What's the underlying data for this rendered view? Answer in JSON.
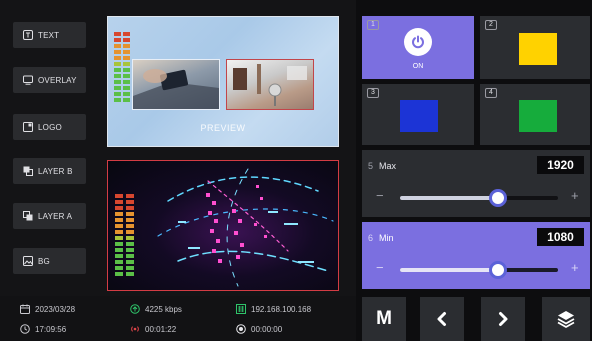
{
  "sources": {
    "text": "TEXT",
    "overlay": "OVERLAY",
    "logo": "LOGO",
    "layer_b": "LAYER B",
    "layer_a": "LAYER A",
    "bg": "BG"
  },
  "preview": {
    "label": "PREVIEW"
  },
  "status": {
    "date": "2023/03/28",
    "time": "17:09:56",
    "bitrate": "4225 kbps",
    "live_duration": "00:01:22",
    "ip": "192.168.100.168",
    "record_duration": "00:00:00"
  },
  "cells": [
    {
      "num": "1",
      "label": "ON",
      "active": true,
      "color": "#7b6fe0"
    },
    {
      "num": "2",
      "color": "#ffd200"
    },
    {
      "num": "3",
      "color": "#1c34d6"
    },
    {
      "num": "4",
      "color": "#16ac3c"
    }
  ],
  "sliders": [
    {
      "num": "5",
      "label": "Max",
      "value": "1920",
      "level": 0.62,
      "minus": "−",
      "plus": "+"
    },
    {
      "num": "6",
      "label": "Min",
      "value": "1080",
      "level": 0.62,
      "minus": "−",
      "plus": "+"
    }
  ],
  "bottom_buttons": {
    "m_label": "M"
  },
  "colors": {
    "accent": "#7b6fe0",
    "red_border": "#d33c44"
  }
}
